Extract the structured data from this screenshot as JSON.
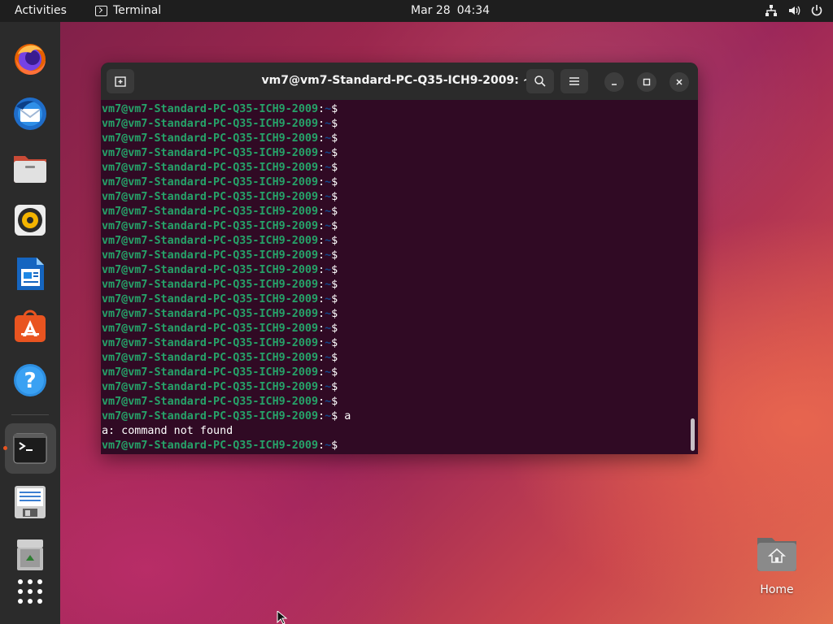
{
  "topbar": {
    "activities": "Activities",
    "app_name": "Terminal",
    "date": "Mar 28",
    "time": "04:34",
    "tray_icons": [
      "network-icon",
      "volume-icon",
      "power-icon"
    ]
  },
  "dock": {
    "items": [
      {
        "name": "firefox",
        "icon": "firefox-icon"
      },
      {
        "name": "thunderbird",
        "icon": "thunderbird-icon"
      },
      {
        "name": "files",
        "icon": "files-icon"
      },
      {
        "name": "rhythmbox",
        "icon": "rhythmbox-icon"
      },
      {
        "name": "libreoffice-writer",
        "icon": "writer-icon"
      },
      {
        "name": "ubuntu-software",
        "icon": "software-icon"
      },
      {
        "name": "help",
        "icon": "help-icon"
      },
      {
        "name": "terminal",
        "icon": "terminal-icon",
        "active": true
      },
      {
        "name": "text-editor",
        "icon": "text-editor-icon"
      },
      {
        "name": "trash",
        "icon": "trash-icon"
      },
      {
        "name": "show-applications",
        "icon": "app-grid-icon"
      }
    ]
  },
  "terminal": {
    "title": "vm7@vm7-Standard-PC-Q35-ICH9-2009: ~",
    "prompt_user": "vm7@vm7-Standard-PC-Q35-ICH9-2009",
    "prompt_sep": ":",
    "prompt_path": "~",
    "prompt_symbol": "$",
    "lines": [
      {
        "type": "prompt",
        "cmd": ""
      },
      {
        "type": "prompt",
        "cmd": ""
      },
      {
        "type": "prompt",
        "cmd": ""
      },
      {
        "type": "prompt",
        "cmd": ""
      },
      {
        "type": "prompt",
        "cmd": ""
      },
      {
        "type": "prompt",
        "cmd": ""
      },
      {
        "type": "prompt",
        "cmd": ""
      },
      {
        "type": "prompt",
        "cmd": ""
      },
      {
        "type": "prompt",
        "cmd": ""
      },
      {
        "type": "prompt",
        "cmd": ""
      },
      {
        "type": "prompt",
        "cmd": ""
      },
      {
        "type": "prompt",
        "cmd": ""
      },
      {
        "type": "prompt",
        "cmd": ""
      },
      {
        "type": "prompt",
        "cmd": ""
      },
      {
        "type": "prompt",
        "cmd": ""
      },
      {
        "type": "prompt",
        "cmd": ""
      },
      {
        "type": "prompt",
        "cmd": ""
      },
      {
        "type": "prompt",
        "cmd": ""
      },
      {
        "type": "prompt",
        "cmd": ""
      },
      {
        "type": "prompt",
        "cmd": ""
      },
      {
        "type": "prompt",
        "cmd": ""
      },
      {
        "type": "prompt",
        "cmd": "a"
      },
      {
        "type": "output",
        "text": "a: command not found"
      },
      {
        "type": "prompt",
        "cmd": ""
      }
    ]
  },
  "desktop": {
    "home_label": "Home"
  },
  "colors": {
    "topbar_bg": "#1e1e1e",
    "dock_bg": "#2b2b2b",
    "terminal_bg": "#300a24",
    "prompt_user": "#26a269",
    "prompt_path": "#12488b",
    "accent": "#e95420"
  }
}
